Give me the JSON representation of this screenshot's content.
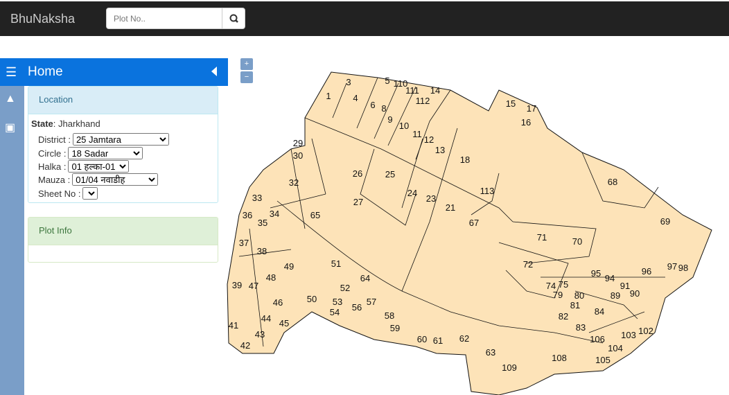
{
  "header": {
    "brand": "BhuNaksha",
    "search_placeholder": "Plot No.."
  },
  "sidebar": {
    "title": "Home",
    "rail_icons": [
      "tree-icon",
      "image-icon"
    ]
  },
  "location": {
    "title": "Location",
    "state_label": "State",
    "state_value": ": Jharkhand",
    "district_label": "District :",
    "district": "25 Jamtara",
    "circle_label": "Circle :",
    "circle": "18 Sadar",
    "halka_label": "Halka :",
    "halka": "01 हल्का-01",
    "mauza_label": "Mauza :",
    "mauza": "01/04 नवाडीह",
    "sheet_label": "Sheet No :",
    "sheet": ""
  },
  "plot_info": {
    "title": "Plot Info"
  },
  "map_controls": {
    "zoom_in": "+",
    "zoom_out": "−"
  },
  "map": {
    "fill": "#fde3b8",
    "plots": [
      "1",
      "3",
      "4",
      "5",
      "110",
      "111",
      "14",
      "112",
      "6",
      "8",
      "9",
      "10",
      "11",
      "12",
      "13",
      "18",
      "15",
      "16",
      "17",
      "29",
      "30",
      "26",
      "25",
      "24",
      "23",
      "21",
      "113",
      "27",
      "32",
      "33",
      "36",
      "35",
      "34",
      "65",
      "67",
      "68",
      "69",
      "71",
      "70",
      "72",
      "37",
      "38",
      "49",
      "51",
      "39",
      "47",
      "48",
      "46",
      "50",
      "52",
      "53",
      "54",
      "56",
      "64",
      "57",
      "58",
      "59",
      "60",
      "61",
      "62",
      "63",
      "109",
      "108",
      "41",
      "44",
      "45",
      "43",
      "42",
      "74",
      "75",
      "79",
      "80",
      "81",
      "82",
      "83",
      "84",
      "95",
      "94",
      "89",
      "90",
      "91",
      "96",
      "97",
      "98",
      "106",
      "103",
      "104",
      "105",
      "102"
    ]
  }
}
